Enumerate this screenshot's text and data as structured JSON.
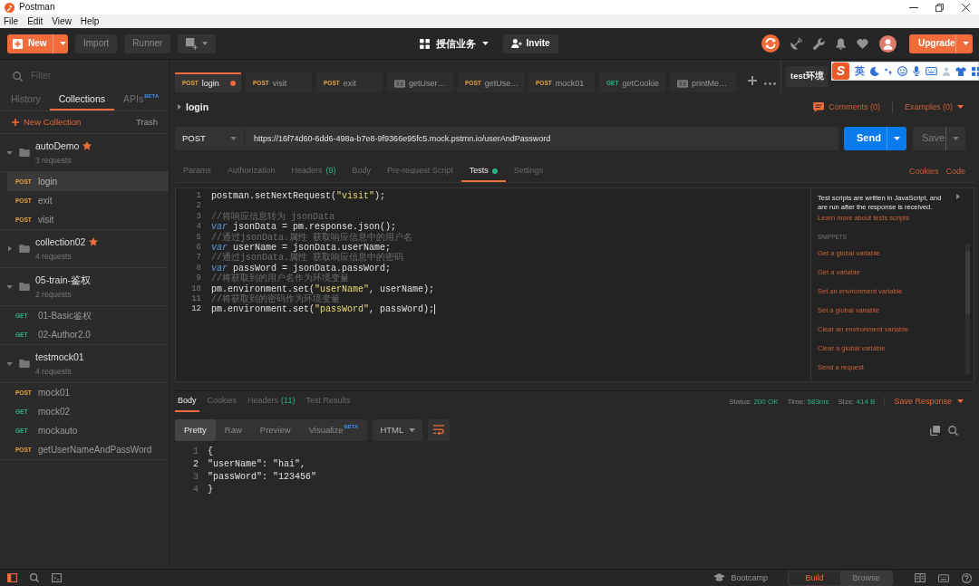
{
  "window": {
    "title": "Postman"
  },
  "menu": [
    {
      "label": "File"
    },
    {
      "label": "Edit"
    },
    {
      "label": "View"
    },
    {
      "label": "Help"
    }
  ],
  "toolbar": {
    "new_button": "New",
    "import_button": "Import",
    "runner_button": "Runner",
    "workspace": "授信业务",
    "invite_button": "Invite",
    "upgrade_button": "Upgrade"
  },
  "sidebar": {
    "filter": {
      "placeholder": "Filter"
    },
    "tabs": [
      {
        "label": "History",
        "selected": false
      },
      {
        "label": "Collections",
        "selected": true
      },
      {
        "label": "APIs",
        "badge": "BETA",
        "selected": false
      }
    ],
    "new_collection": "New Collection",
    "trash": "Trash",
    "collections": [
      {
        "name": "autoDemo",
        "count": "3 requests",
        "favorite": true,
        "expanded": true,
        "requests": [
          {
            "method": "POST",
            "color": "#e8a33d",
            "name": "login",
            "selected": true
          },
          {
            "method": "POST",
            "color": "#e8a33d",
            "name": "exit",
            "selected": false
          },
          {
            "method": "POST",
            "color": "#e8a33d",
            "name": "visit",
            "selected": false
          }
        ]
      },
      {
        "name": "collection02",
        "count": "4 requests",
        "favorite": true,
        "expanded": false
      },
      {
        "name": "05-train-鉴权",
        "count": "2 requests",
        "favorite": false,
        "expanded": true,
        "requests": [
          {
            "method": "GET",
            "color": "#2db37d",
            "name": "01-Basic鉴权",
            "selected": false
          },
          {
            "method": "GET",
            "color": "#2db37d",
            "name": "02-Author2.0",
            "selected": false
          }
        ]
      },
      {
        "name": "testmock01",
        "count": "4 requests",
        "favorite": false,
        "expanded": true,
        "requests": [
          {
            "method": "POST",
            "color": "#e8a33d",
            "name": "mock01",
            "selected": false
          },
          {
            "method": "GET",
            "color": "#2db37d",
            "name": "mock02",
            "selected": false
          },
          {
            "method": "GET",
            "color": "#2db37d",
            "name": "mockauto",
            "selected": false
          },
          {
            "method": "POST",
            "color": "#e8a33d",
            "name": "getUserNameAndPassWord",
            "selected": false
          }
        ]
      }
    ]
  },
  "request_tabs": [
    {
      "kind": "request",
      "method": "POST",
      "color": "#e8a33d",
      "name": "login",
      "selected": true,
      "unsaved": true
    },
    {
      "kind": "request",
      "method": "POST",
      "color": "#e8a33d",
      "name": "visit",
      "selected": false,
      "unsaved": false
    },
    {
      "kind": "request",
      "method": "POST",
      "color": "#e8a33d",
      "name": "exit",
      "selected": false,
      "unsaved": false
    },
    {
      "kind": "example",
      "name": "getUser…",
      "selected": false,
      "unsaved": false
    },
    {
      "kind": "request",
      "method": "POST",
      "color": "#e8a33d",
      "name": "getUse…",
      "selected": false,
      "unsaved": false
    },
    {
      "kind": "request",
      "method": "POST",
      "color": "#e8a33d",
      "name": "mock01",
      "selected": false,
      "unsaved": false
    },
    {
      "kind": "request",
      "method": "GET",
      "color": "#2db37d",
      "name": "getCookie",
      "selected": false,
      "unsaved": false
    },
    {
      "kind": "example",
      "name": "printMe…",
      "selected": false,
      "unsaved": false
    }
  ],
  "environment": {
    "name": "test环境"
  },
  "request": {
    "name": "login",
    "comments": "Comments (0)",
    "examples": "Examples (0)",
    "method": "POST",
    "url": "https://16f74d60-6dd6-498a-b7e8-9f9366e95fc5.mock.pstmn.io/userAndPassword",
    "send_button": "Send",
    "save_button": "Save",
    "sections": [
      {
        "label": "Params",
        "selected": false,
        "dot": false
      },
      {
        "label": "Authorization",
        "selected": false,
        "dot": false
      },
      {
        "label": "Headers",
        "count": "(9)",
        "selected": false,
        "dot": false
      },
      {
        "label": "Body",
        "selected": false,
        "dot": false
      },
      {
        "label": "Pre-request Script",
        "selected": false,
        "dot": false
      },
      {
        "label": "Tests",
        "selected": true,
        "dot": true
      },
      {
        "label": "Settings",
        "selected": false,
        "dot": false
      }
    ],
    "cookies_link": "Cookies",
    "code_link": "Code",
    "editor": {
      "lines": [
        {
          "number": "1",
          "cursor": false,
          "tokens": [
            {
              "kind": "plain",
              "text": "postman.setNextRequest("
            },
            {
              "kind": "string",
              "text": "\"visit\""
            },
            {
              "kind": "plain",
              "text": ");"
            }
          ]
        },
        {
          "number": "2",
          "cursor": false
        },
        {
          "number": "3",
          "cursor": false,
          "tokens": [
            {
              "kind": "comment",
              "text": "//将响应信息转为 jsonData"
            }
          ]
        },
        {
          "number": "4",
          "cursor": false,
          "tokens": [
            {
              "kind": "keyword",
              "text": "var"
            },
            {
              "kind": "plain",
              "text": " jsonData = pm.response.json();"
            }
          ]
        },
        {
          "number": "5",
          "cursor": false,
          "tokens": [
            {
              "kind": "comment",
              "text": "//通过jsonData.属性 获取响应信息中的用户名"
            }
          ]
        },
        {
          "number": "6",
          "cursor": false,
          "tokens": [
            {
              "kind": "keyword",
              "text": "var"
            },
            {
              "kind": "plain",
              "text": " userName = jsonData.userName;"
            }
          ]
        },
        {
          "number": "7",
          "cursor": false,
          "tokens": [
            {
              "kind": "comment",
              "text": "//通过jsonData.属性 获取响应信息中的密码"
            }
          ]
        },
        {
          "number": "8",
          "cursor": false,
          "tokens": [
            {
              "kind": "keyword",
              "text": "var"
            },
            {
              "kind": "plain",
              "text": " passWord = jsonData.passWord;"
            }
          ]
        },
        {
          "number": "9",
          "cursor": false,
          "tokens": [
            {
              "kind": "comment",
              "text": "//将获取到的用户名作为环境变量"
            }
          ]
        },
        {
          "number": "10",
          "cursor": false,
          "tokens": [
            {
              "kind": "plain",
              "text": "pm.environment.set("
            },
            {
              "kind": "string",
              "text": "\"userName\""
            },
            {
              "kind": "plain",
              "text": ", userName);"
            }
          ]
        },
        {
          "number": "11",
          "cursor": false,
          "tokens": [
            {
              "kind": "comment",
              "text": "//将获取到的密码作为环境变量"
            }
          ]
        },
        {
          "number": "12",
          "cursor": true,
          "tokens": [
            {
              "kind": "plain",
              "text": "pm.environment.set("
            },
            {
              "kind": "string",
              "text": "\"passWord\""
            },
            {
              "kind": "plain",
              "text": ", passWord);"
            }
          ]
        }
      ]
    },
    "snippets": {
      "description": "Test scripts are written in JavaScript, and are run after the response is received.",
      "learn_more": "Learn more about tests scripts",
      "heading": "SNIPPETS",
      "items": [
        "Get a global variable",
        "Get a variable",
        "Set an environment variable",
        "Set a global variable",
        "Clear an environment variable",
        "Clear a global variable",
        "Send a request"
      ]
    }
  },
  "response": {
    "tabs": [
      {
        "label": "Body",
        "selected": true
      },
      {
        "label": "Cookies",
        "selected": false
      },
      {
        "label": "Headers",
        "count": "(11)",
        "selected": false
      },
      {
        "label": "Test Results",
        "selected": false
      }
    ],
    "status": {
      "label": "Status:",
      "value": "200 OK"
    },
    "time": {
      "label": "Time:",
      "value": "583ms"
    },
    "size": {
      "label": "Size:",
      "value": "414 B"
    },
    "save_button": "Save Response",
    "views": [
      {
        "label": "Pretty",
        "selected": true
      },
      {
        "label": "Raw",
        "selected": false
      },
      {
        "label": "Preview",
        "selected": false
      },
      {
        "label": "Visualize",
        "badge": "BETA",
        "selected": false
      }
    ],
    "format": "HTML",
    "lines": [
      {
        "number": "1",
        "text": "{",
        "current": false
      },
      {
        "number": "2",
        "text": "\"userName\": \"hai\",",
        "current": true
      },
      {
        "number": "3",
        "text": "\"passWord\": \"123456\"",
        "current": false
      },
      {
        "number": "4",
        "text": "}",
        "current": false
      }
    ]
  },
  "status_bar": {
    "bootcamp": "Bootcamp",
    "modes": [
      {
        "label": "Build",
        "selected": true
      },
      {
        "label": "Browse",
        "selected": false
      }
    ]
  },
  "ime_toolbar": {
    "logo": "S",
    "mode": "英"
  }
}
